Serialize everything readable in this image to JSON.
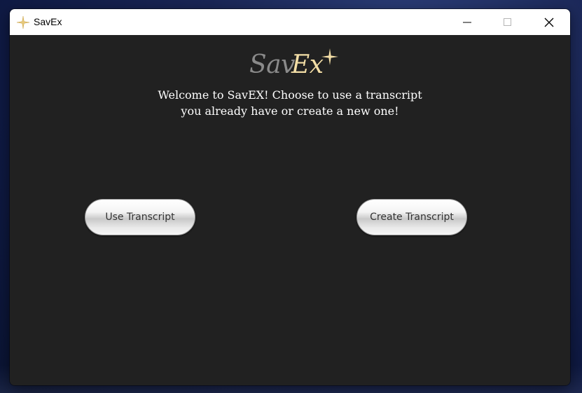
{
  "window": {
    "title": "SavEx",
    "controls": {
      "minimize_icon": "minimize-icon",
      "maximize_icon": "maximize-icon",
      "close_icon": "close-icon"
    }
  },
  "logo": {
    "part1": "Sav",
    "part2": "Ex",
    "star_icon": "sparkle-star-icon",
    "color_part1": "#8a8a8a",
    "color_part2": "#f3dea6"
  },
  "main": {
    "welcome_line1": "Welcome to SavEX! Choose to use a transcript",
    "welcome_line2": "you already have or create a new one!",
    "buttons": {
      "use_label": "Use Transcript",
      "create_label": "Create Transcript"
    }
  },
  "colors": {
    "background": "#212121",
    "titlebar": "#ffffff",
    "text": "#ffffff",
    "button_text": "#333333"
  }
}
